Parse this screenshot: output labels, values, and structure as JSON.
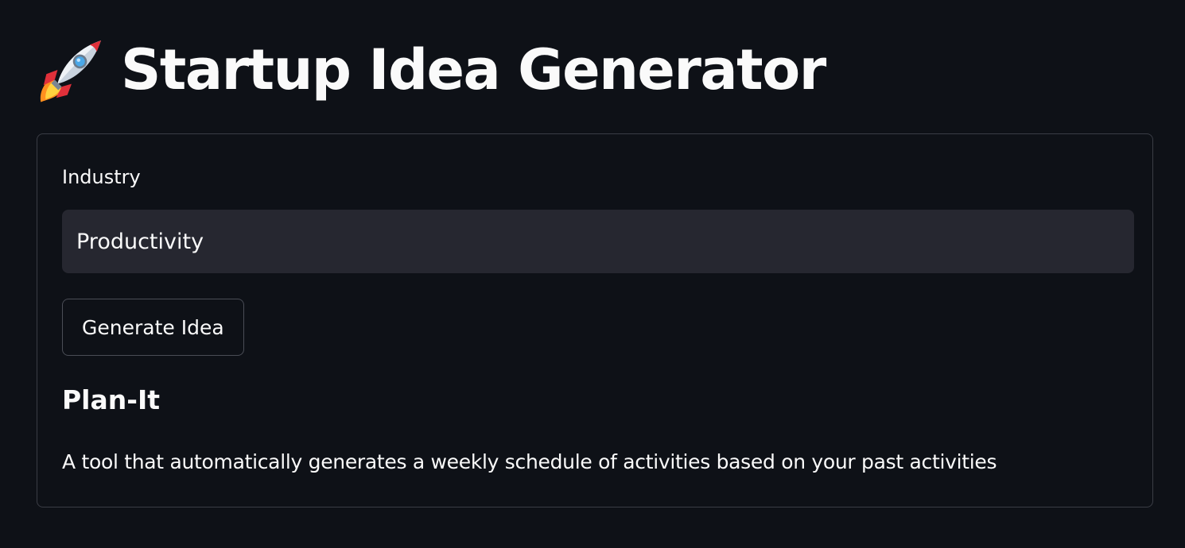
{
  "header": {
    "icon": "rocket-icon",
    "title": "Startup Idea Generator"
  },
  "form": {
    "industry_label": "Industry",
    "industry_value": "Productivity",
    "generate_label": "Generate Idea"
  },
  "result": {
    "idea_name": "Plan-It",
    "idea_description": "A tool that automatically generates a weekly schedule of activities based on your past activities"
  },
  "colors": {
    "background": "#0e1117",
    "input_background": "#262730",
    "text": "#fafafa",
    "border": "#3a3d45"
  }
}
